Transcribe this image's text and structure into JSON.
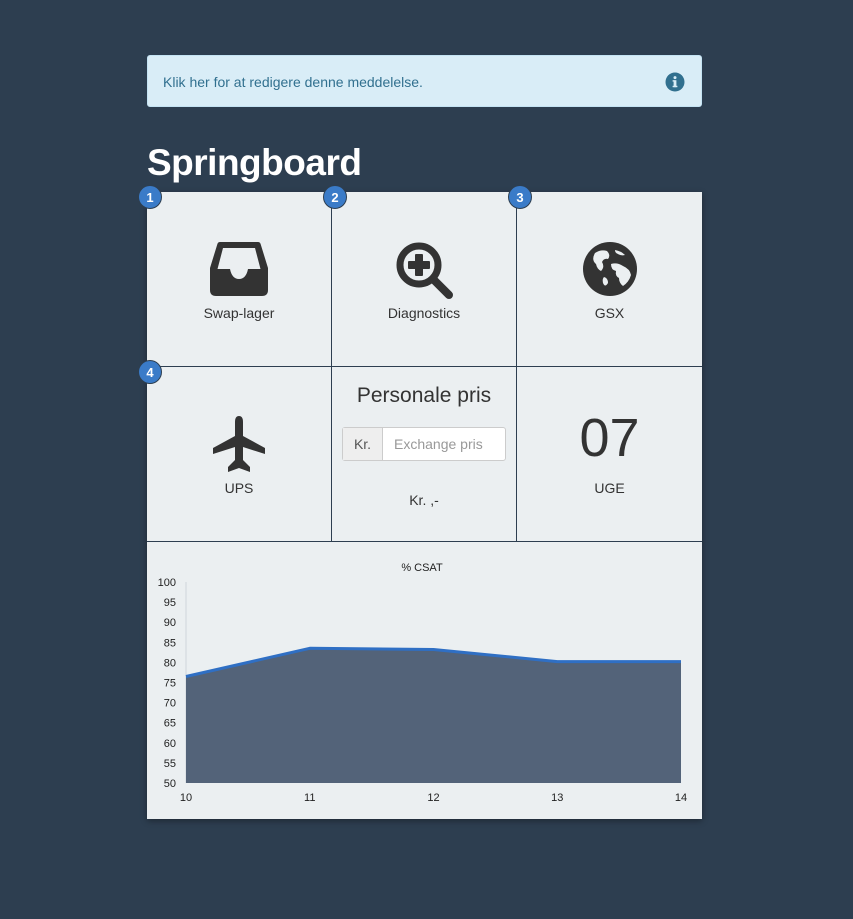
{
  "notice": {
    "text": "Klik her for at redigere denne meddelelse.",
    "icon": "info-circle-icon"
  },
  "page": {
    "title": "Springboard"
  },
  "tiles": [
    {
      "badge": "1",
      "label": "Swap-lager",
      "icon": "inbox-tray-icon"
    },
    {
      "badge": "2",
      "label": "Diagnostics",
      "icon": "zoom-plus-icon"
    },
    {
      "badge": "3",
      "label": "GSX",
      "icon": "globe-icon"
    },
    {
      "badge": "4",
      "label": "UPS",
      "icon": "airplane-icon"
    }
  ],
  "price_widget": {
    "title": "Personale pris",
    "addon": "Kr.",
    "placeholder": "Exchange pris",
    "value": "",
    "result": "Kr. ,-"
  },
  "week_widget": {
    "number": "07",
    "label": "UGE"
  },
  "colors": {
    "background": "#2d3e50",
    "accent": "#3a7bc8",
    "area": "#536379",
    "line": "#2f6fc4"
  },
  "chart_data": {
    "type": "area",
    "title": "% CSAT",
    "x": [
      10,
      11,
      12,
      13,
      14
    ],
    "series": [
      {
        "values": [
          76.5,
          83.5,
          83.2,
          80.2,
          80.2
        ]
      }
    ],
    "xlabel": "",
    "ylabel": "",
    "ylim": [
      50,
      100
    ],
    "yticks": [
      100,
      95,
      90,
      85,
      80,
      75,
      70,
      65,
      60,
      55,
      50
    ],
    "grid": false,
    "legend": "none"
  }
}
